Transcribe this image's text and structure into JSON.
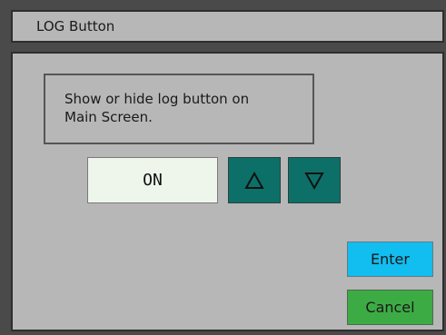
{
  "window": {
    "title": "LOG Button"
  },
  "description": {
    "line1": "Show or hide log button on",
    "line2": "Main Screen."
  },
  "setting": {
    "value": "ON"
  },
  "controls": {
    "up_icon": "triangle-up-outline-icon",
    "down_icon": "triangle-down-outline-icon",
    "enter_label": "Enter",
    "cancel_label": "Cancel"
  },
  "colors": {
    "title_bar": "#b7b7b7",
    "frame": "#4a4a4a",
    "value_bg": "#eef6ec",
    "arrow_bg": "#0d7068",
    "enter_bg": "#12bdf0",
    "cancel_bg": "#3dab44"
  }
}
